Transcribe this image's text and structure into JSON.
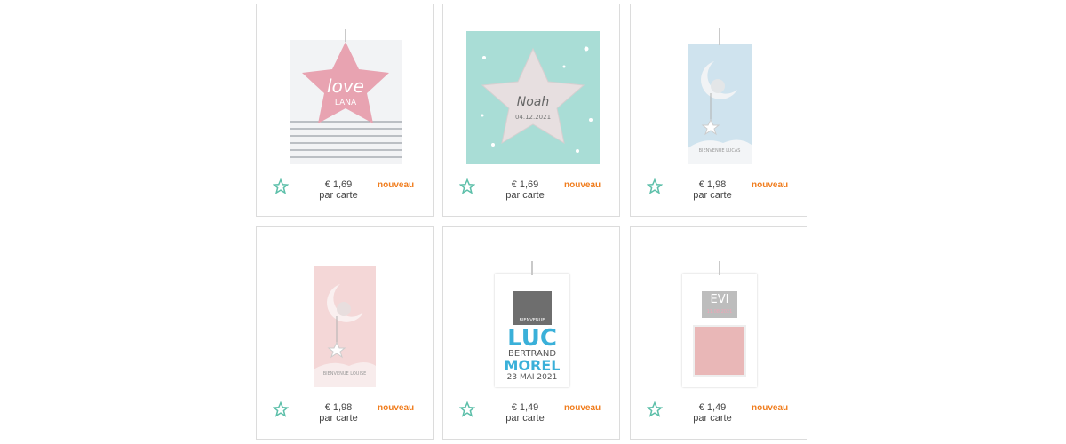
{
  "products": [
    {
      "price": "€ 1,69",
      "unit": "par carte",
      "badge": "nouveau",
      "card_text": [
        "love",
        "LANA"
      ]
    },
    {
      "price": "€ 1,69",
      "unit": "par carte",
      "badge": "nouveau",
      "card_text": [
        "Noah",
        "04.12.2021"
      ]
    },
    {
      "price": "€ 1,98",
      "unit": "par carte",
      "badge": "nouveau",
      "card_text": [
        "BIENVENUE",
        "LUCAS"
      ]
    },
    {
      "price": "€ 1,98",
      "unit": "par carte",
      "badge": "nouveau",
      "card_text": [
        "BIENVENUE",
        "LOUISE"
      ]
    },
    {
      "price": "€ 1,49",
      "unit": "par carte",
      "badge": "nouveau",
      "card_text": [
        "BIENVENUE",
        "LUC",
        "BERTRAND",
        "MOREL",
        "23 MAI 2021"
      ]
    },
    {
      "price": "€ 1,49",
      "unit": "par carte",
      "badge": "nouveau",
      "card_text": [
        "EVI",
        "11.08.2021"
      ]
    }
  ],
  "colors": {
    "accent_star": "#5cbfa9",
    "badge": "#f07d1e",
    "border": "#dcdcdc"
  },
  "icons": {
    "favorite": "star-outline-icon"
  }
}
